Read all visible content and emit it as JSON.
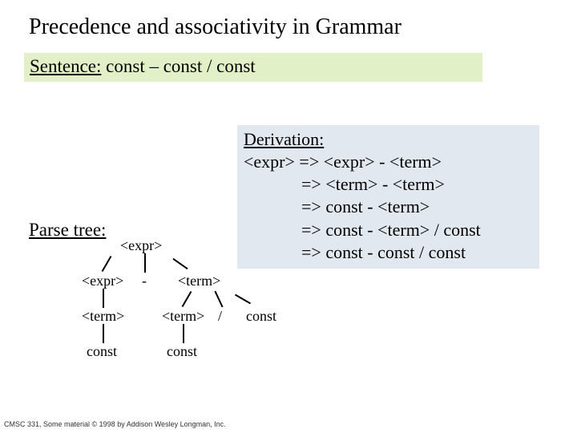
{
  "title": "Precedence and associativity in Grammar",
  "sentence": {
    "label": "Sentence:",
    "text": " const – const / const"
  },
  "derivation": {
    "title": "Derivation:",
    "lines": [
      "<expr> => <expr> - <term>",
      "=> <term> - <term>",
      "=> const - <term>",
      "=> const - <term> / const",
      "=> const - const / const"
    ]
  },
  "parse": {
    "label": "Parse tree:",
    "nodes": {
      "root": "<expr>",
      "l1a": "<expr>",
      "l1b": "-",
      "l1c": "<term>",
      "l2a": "<term>",
      "l2b": "<term>",
      "l2c": "/",
      "l2d": "const",
      "l3a": "const",
      "l3b": "const"
    }
  },
  "footer": "CMSC 331, Some material © 1998 by Addison Wesley Longman, Inc."
}
